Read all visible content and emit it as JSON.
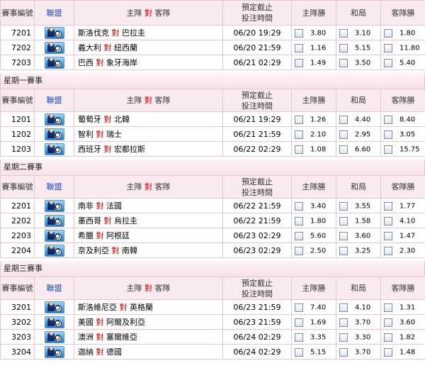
{
  "headers": {
    "id": "賽事編號",
    "league": "聯盟",
    "matchup": {
      "home": "主隊",
      "vs": "對",
      "away": "客隊"
    },
    "deadline": [
      "預定截止",
      "投注時間"
    ],
    "home_win": "主隊勝",
    "draw": "和局",
    "away_win": "客隊勝"
  },
  "groups": [
    {
      "title": "",
      "matches": [
        {
          "id": "7201",
          "league_icon": "soccer-league-icon",
          "home": "斯洛伐克",
          "away": "巴拉圭",
          "time": "06/20 19:29",
          "odds": [
            "3.80",
            "3.10",
            "1.80"
          ]
        },
        {
          "id": "7202",
          "league_icon": "soccer-league-icon",
          "home": "義大利",
          "away": "紐西蘭",
          "time": "06/20 21:59",
          "odds": [
            "1.16",
            "5.15",
            "11.80"
          ]
        },
        {
          "id": "7203",
          "league_icon": "soccer-league-icon",
          "home": "巴西",
          "away": "象牙海岸",
          "time": "06/21 02:29",
          "odds": [
            "1.49",
            "3.50",
            "5.40"
          ]
        }
      ]
    },
    {
      "title": "星期一賽事",
      "matches": [
        {
          "id": "1201",
          "league_icon": "soccer-league-icon",
          "home": "葡萄牙",
          "away": "北韓",
          "time": "06/21 19:29",
          "odds": [
            "1.26",
            "4.40",
            "8.40"
          ]
        },
        {
          "id": "1202",
          "league_icon": "soccer-league-icon",
          "home": "智利",
          "away": "瑞士",
          "time": "06/21 21:59",
          "odds": [
            "2.10",
            "2.95",
            "3.05"
          ]
        },
        {
          "id": "1203",
          "league_icon": "soccer-league-icon",
          "home": "西班牙",
          "away": "宏都拉斯",
          "time": "06/22 02:29",
          "odds": [
            "1.08",
            "6.60",
            "15.75"
          ]
        }
      ]
    },
    {
      "title": "星期二賽事",
      "matches": [
        {
          "id": "2201",
          "league_icon": "soccer-league-icon",
          "home": "南非",
          "away": "法國",
          "time": "06/22 21:59",
          "odds": [
            "3.40",
            "3.55",
            "1.77"
          ]
        },
        {
          "id": "2202",
          "league_icon": "soccer-league-icon",
          "home": "墨西哥",
          "away": "烏拉圭",
          "time": "06/22 21:59",
          "odds": [
            "1.80",
            "1.58",
            "4.10"
          ]
        },
        {
          "id": "2203",
          "league_icon": "soccer-league-icon",
          "home": "希臘",
          "away": "阿根廷",
          "time": "06/23 02:29",
          "odds": [
            "5.60",
            "3.60",
            "1.47"
          ]
        },
        {
          "id": "2204",
          "league_icon": "soccer-league-icon",
          "home": "奈及利亞",
          "away": "南韓",
          "time": "06/23 02:29",
          "odds": [
            "2.50",
            "3.25",
            "2.30"
          ]
        }
      ]
    },
    {
      "title": "星期三賽事",
      "matches": [
        {
          "id": "3201",
          "league_icon": "soccer-league-icon",
          "home": "斯洛維尼亞",
          "away": "英格蘭",
          "time": "06/23 21:59",
          "odds": [
            "7.40",
            "4.10",
            "1.31"
          ]
        },
        {
          "id": "3202",
          "league_icon": "soccer-league-icon",
          "home": "美國",
          "away": "阿爾及利亞",
          "time": "06/23 21:59",
          "odds": [
            "1.69",
            "3.70",
            "3.60"
          ]
        },
        {
          "id": "3203",
          "league_icon": "soccer-league-icon",
          "home": "澳洲",
          "away": "塞爾維亞",
          "time": "06/24 02:29",
          "odds": [
            "3.35",
            "3.30",
            "1.82"
          ]
        },
        {
          "id": "3204",
          "league_icon": "soccer-league-icon",
          "home": "迦納",
          "away": "德國",
          "time": "06/24 02:29",
          "odds": [
            "5.15",
            "3.70",
            "1.48"
          ]
        }
      ]
    }
  ],
  "colors": {
    "vs": "#cc0000",
    "header_bg": "#f9eaf0",
    "border": "#e3c6cf",
    "league_link": "#1a49b5"
  }
}
